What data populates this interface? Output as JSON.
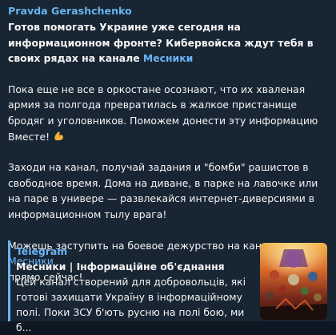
{
  "message": {
    "sender": "Pravda Gerashchenko",
    "headline_text": "Готов помогать Украине уже сегодня на информационном фронте? Кибервойска ждут тебя в своих рядах на канале ",
    "headline_link": "Месники",
    "paragraph1": "Пока еще не все в оркостане осознают, что их хваленая армия за полгода превратилась в жалкое пристанище бродяг и уголовников. Поможем донести эту информацию Вместе!",
    "paragraph1_emoji": "flexed-biceps-emoji",
    "paragraph2": "Заходи на канал, получай задания и \"бомби\" рашистов в свободное время. Дома на диване, в парке на лавочке или на паре в универе — развлекайся интернет-диверсиями в информационном тылу врага!",
    "paragraph3_text": "Можешь заступить на боевое дежурство на канале ",
    "paragraph3_link": "Месники",
    "paragraph3_tail": "прямо сейчас!"
  },
  "link_preview": {
    "site": "Telegram",
    "title": "Месники | Інформаційне об'єднання",
    "description": "Цей канал створений для добровольців, які готові захищати Україну в інформаційному полі. Поки ЗСУ б'ють русню на полі бою, ми б...",
    "thumbnail_icon": "movie-poster-thumbnail"
  },
  "colors": {
    "background": "#182533",
    "accent": "#6ab3f3",
    "sender": "#64b5ef",
    "text": "#f5f5f5"
  }
}
